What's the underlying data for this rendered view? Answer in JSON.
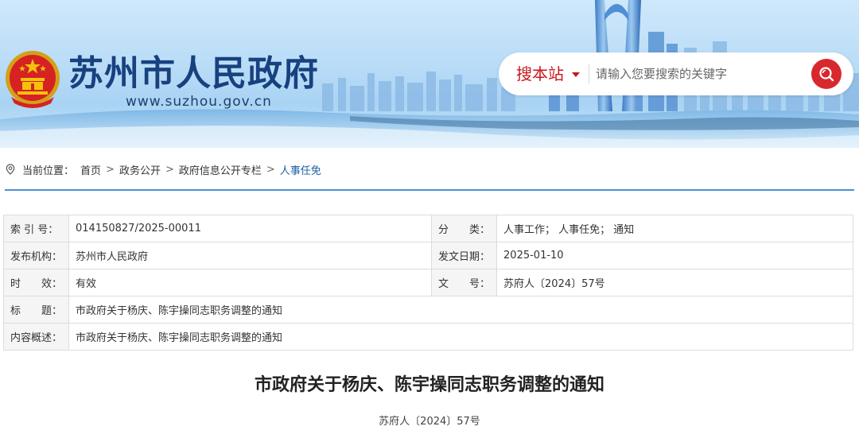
{
  "header": {
    "site_title": "苏州市人民政府",
    "site_url": "www.suzhou.gov.cn"
  },
  "search": {
    "scope_label": "搜本站",
    "placeholder": "请输入您要搜索的关键字",
    "button_icon": "search-icon",
    "accent_color": "#d9272e"
  },
  "breadcrumb": {
    "prefix": "当前位置：",
    "items": [
      "首页",
      "政务公开",
      "政府信息公开专栏",
      "人事任免"
    ],
    "separator": ">"
  },
  "info": {
    "index_label": "索 引 号：",
    "index_value": "014150827/2025-00011",
    "category_label_a": "分",
    "category_label_b": "类：",
    "category_value": "人事工作；  人事任免；  通知",
    "publisher_label": "发布机构：",
    "publisher_value": "苏州市人民政府",
    "date_label": "发文日期：",
    "date_value": "2025-01-10",
    "validity_label_a": "时",
    "validity_label_b": "效：",
    "validity_value": "有效",
    "docno_label_a": "文",
    "docno_label_b": "号：",
    "docno_value": "苏府人〔2024〕57号",
    "title_label_a": "标",
    "title_label_b": "题：",
    "title_value": "市政府关于杨庆、陈宇操同志职务调整的通知",
    "summary_label": "内容概述：",
    "summary_value": "市政府关于杨庆、陈宇操同志职务调整的通知"
  },
  "article": {
    "title": "市政府关于杨庆、陈宇操同志职务调整的通知",
    "doc_number": "苏府人〔2024〕57号"
  }
}
